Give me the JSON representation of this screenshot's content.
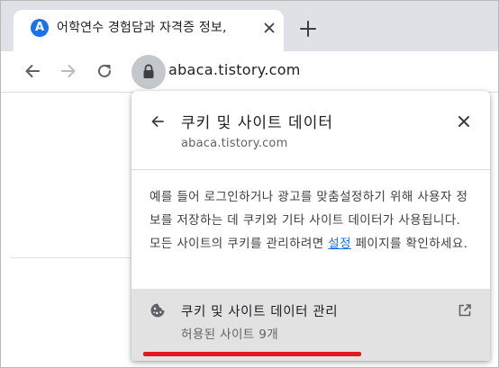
{
  "tab": {
    "favicon_letter": "A",
    "title": "어학연수 경험담과 자격증 정보,"
  },
  "toolbar": {
    "url": "abaca.tistory.com"
  },
  "popup": {
    "title": "쿠키 및 사이트 데이터",
    "subtitle": "abaca.tistory.com",
    "description_before_link": "예를 들어 로그인하거나 광고를 맞춤설정하기 위해 사용자 정보를 저장하는 데 쿠키와 기타 사이트 데이터가 사용됩니다. 모든 사이트의 쿠키를 관리하려면 ",
    "settings_link": "설정",
    "description_after_link": " 페이지를 확인하세요.",
    "manage": {
      "title": "쿠키 및 사이트 데이터 관리",
      "subtitle": "허용된 사이트 9개"
    }
  },
  "colors": {
    "accent": "#1a73e8",
    "highlight": "#e11921",
    "row_bg": "#e2e2e2"
  }
}
